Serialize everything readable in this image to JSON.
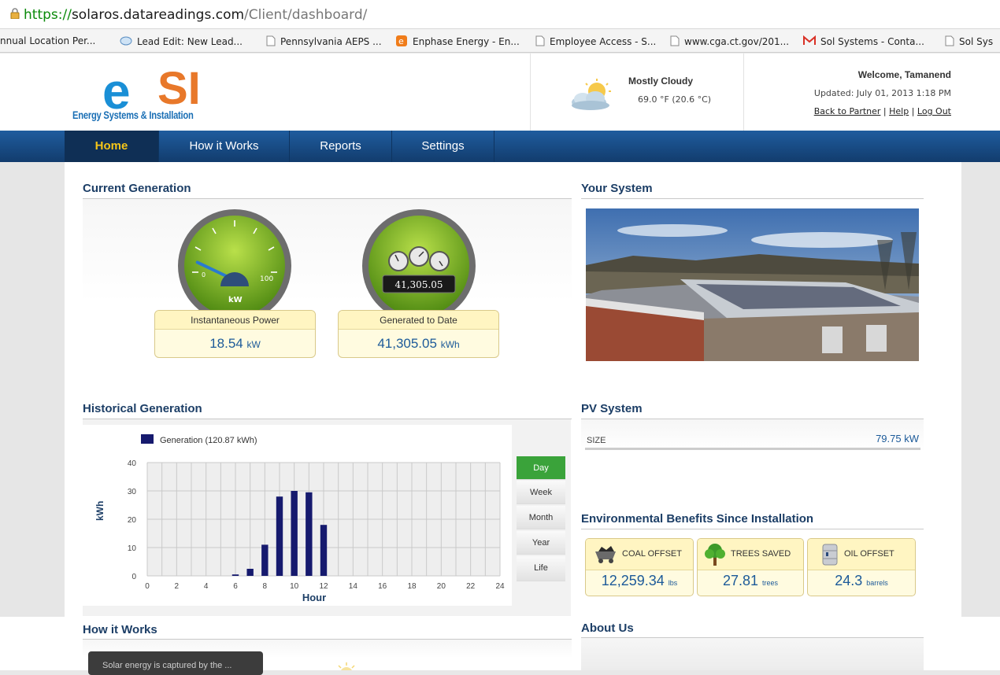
{
  "browser": {
    "url_scheme": "https://",
    "url_host": "solaros.datareadings.com",
    "url_path": "/Client/dashboard/",
    "bookmarks": [
      "nnual Location Per...",
      "Lead Edit: New Lead...",
      "Pennsylvania AEPS ...",
      "Enphase Energy - En...",
      "Employee Access - S...",
      "www.cga.ct.gov/201...",
      "Sol Systems - Conta...",
      "Sol Sys"
    ]
  },
  "header": {
    "logo_e": "e",
    "logo_si": "SI",
    "logo_tagline": "Energy Systems & Installation",
    "weather": {
      "condition": "Mostly Cloudy",
      "temperature": "69.0 °F (20.6 °C)"
    },
    "welcome": "Welcome, Tamanend",
    "updated": "Updated: July 01, 2013 1:18 PM",
    "links": [
      "Back to Partner",
      "Help",
      "Log Out"
    ]
  },
  "nav": [
    "Home",
    "How it Works",
    "Reports",
    "Settings"
  ],
  "current_generation": {
    "title": "Current Generation",
    "gauge_min": "0",
    "gauge_max": "100",
    "gauge_unit": "kW",
    "gauge_level": 0.18,
    "odometer": "41,305.05",
    "instantaneous": {
      "label": "Instantaneous Power",
      "value": "18.54",
      "unit": "kW"
    },
    "to_date": {
      "label": "Generated to Date",
      "value": "41,305.05",
      "unit": "kWh"
    }
  },
  "your_system": {
    "title": "Your System"
  },
  "historical": {
    "title": "Historical Generation",
    "ranges": [
      "Day",
      "Week",
      "Month",
      "Year",
      "Life"
    ],
    "active_range": "Day"
  },
  "chart_data": {
    "type": "bar",
    "legend": "Generation (120.87 kWh)",
    "xlabel": "Hour",
    "ylabel": "kWh",
    "x_ticks": [
      0,
      2,
      4,
      6,
      8,
      10,
      12,
      14,
      16,
      18,
      20,
      22,
      24
    ],
    "y_ticks": [
      0,
      10,
      20,
      30,
      40
    ],
    "xlim": [
      0,
      24
    ],
    "ylim": [
      0,
      40
    ],
    "grid": true,
    "series": [
      {
        "name": "Generation (120.87 kWh)",
        "x": [
          6,
          7,
          8,
          9,
          10,
          11,
          12
        ],
        "values": [
          0.5,
          2.5,
          11,
          28,
          30,
          29.5,
          18
        ]
      }
    ],
    "colors": {
      "bar": "#161a6e"
    }
  },
  "pv_system": {
    "title": "PV System",
    "size_label": "SIZE",
    "size_value": "79.75 kW"
  },
  "environmental": {
    "title": "Environmental Benefits Since Installation",
    "items": [
      {
        "label": "COAL OFFSET",
        "value": "12,259.34",
        "unit": "lbs"
      },
      {
        "label": "TREES SAVED",
        "value": "27.81",
        "unit": "trees"
      },
      {
        "label": "OIL OFFSET",
        "value": "24.3",
        "unit": "barrels"
      }
    ]
  },
  "how_it_works": {
    "title": "How it Works",
    "tooltip": "Solar energy is captured by the ..."
  },
  "about_us": {
    "title": "About Us"
  }
}
